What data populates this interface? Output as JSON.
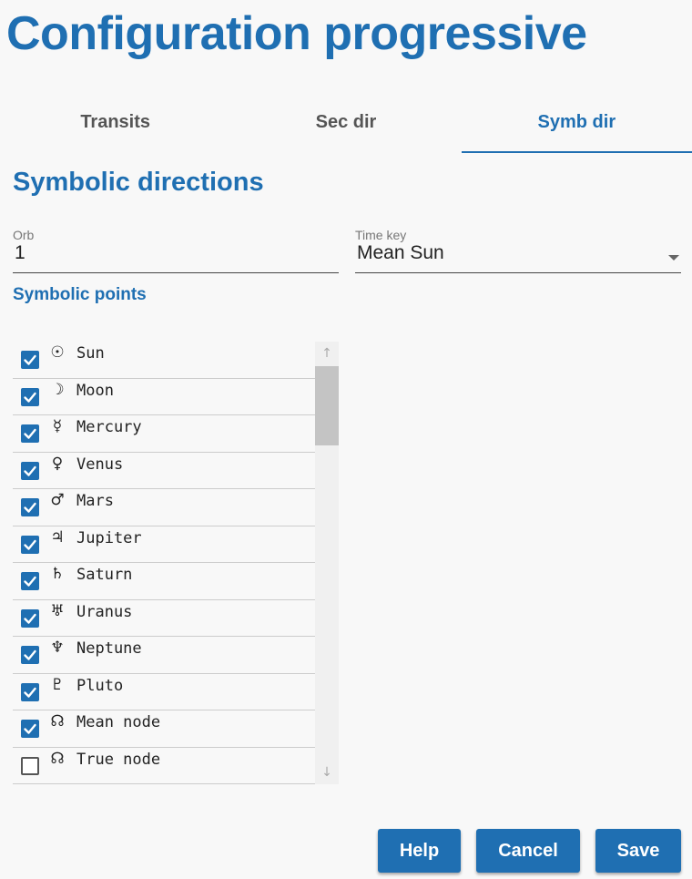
{
  "page": {
    "title": "Configuration progressive"
  },
  "tabs": [
    {
      "label": "Transits",
      "active": false
    },
    {
      "label": "Sec dir",
      "active": false
    },
    {
      "label": "Symb dir",
      "active": true
    }
  ],
  "section": {
    "title": "Symbolic directions",
    "orb": {
      "label": "Orb",
      "value": "1"
    },
    "time_key": {
      "label": "Time key",
      "value": "Mean Sun"
    },
    "points_title": "Symbolic points",
    "points": [
      {
        "glyph": "☉",
        "label": "Sun",
        "checked": true
      },
      {
        "glyph": "☽",
        "label": "Moon",
        "checked": true
      },
      {
        "glyph": "☿",
        "label": "Mercury",
        "checked": true
      },
      {
        "glyph": "♀",
        "label": "Venus",
        "checked": true
      },
      {
        "glyph": "♂",
        "label": "Mars",
        "checked": true
      },
      {
        "glyph": "♃",
        "label": "Jupiter",
        "checked": true
      },
      {
        "glyph": "♄",
        "label": "Saturn",
        "checked": true
      },
      {
        "glyph": "♅",
        "label": "Uranus",
        "checked": true
      },
      {
        "glyph": "♆",
        "label": "Neptune",
        "checked": true
      },
      {
        "glyph": "♇",
        "label": "Pluto",
        "checked": true
      },
      {
        "glyph": "☊",
        "label": "Mean node",
        "checked": true
      },
      {
        "glyph": "☊",
        "label": "True node",
        "checked": false
      }
    ]
  },
  "scrollbar": {
    "up_icon": "arrow-up-icon",
    "down_icon": "arrow-down-icon"
  },
  "buttons": {
    "help": "Help",
    "cancel": "Cancel",
    "save": "Save"
  },
  "colors": {
    "accent": "#1f6fb2",
    "background": "#f8f8f8"
  }
}
